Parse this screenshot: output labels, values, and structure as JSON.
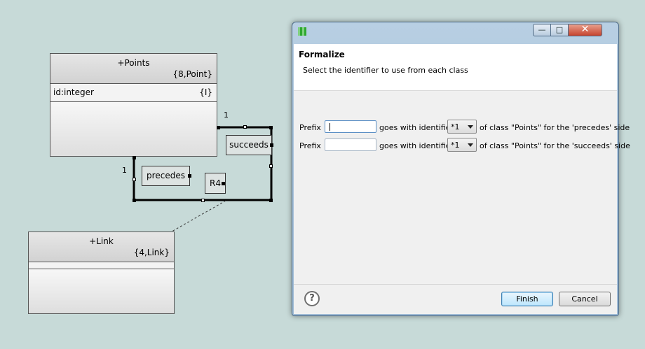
{
  "canvas": {
    "points_class": {
      "name": "+Points",
      "keyletters": "{8,Point}",
      "attribute": "id:integer",
      "attribute_tag": "{I}"
    },
    "link_class": {
      "name": "+Link",
      "keyletters": "{4,Link}"
    },
    "relationship": {
      "id": "R4",
      "phrase_a": "succeeds",
      "phrase_b": "precedes",
      "mult_a": "1",
      "mult_b": "1"
    }
  },
  "dialog": {
    "title": "Formalize",
    "message": "Select the identifier to use from each class",
    "window_buttons": {
      "minimize": "—",
      "maximize": "□",
      "close": "✕"
    },
    "rows": [
      {
        "prefix_label": "Prefix",
        "prefix_value": "",
        "goes_with": "goes with identifier",
        "identifier": "*1",
        "of_class": "of class \"Points\" for the 'precedes' side"
      },
      {
        "prefix_label": "Prefix",
        "prefix_value": "",
        "goes_with": "goes with identifier",
        "identifier": "*1",
        "of_class": "of class \"Points\" for the 'succeeds' side"
      }
    ],
    "help_icon": "?",
    "finish_label": "Finish",
    "cancel_label": "Cancel"
  },
  "colors": {
    "canvas_bg": "#c7dad8",
    "dialog_frame": "#a9c3dc",
    "close_button": "#c6432d"
  }
}
